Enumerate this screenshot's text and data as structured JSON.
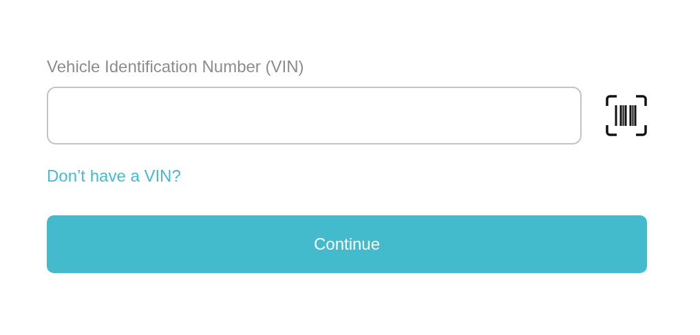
{
  "field": {
    "label": "Vehicle Identification Number (VIN)"
  },
  "link": "Don’t have a VIN?",
  "button": "Continue"
}
